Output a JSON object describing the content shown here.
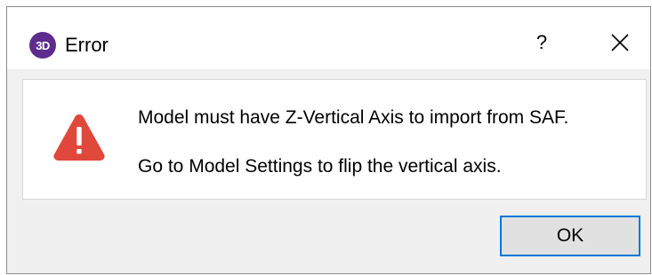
{
  "dialog": {
    "title": "Error",
    "app_icon_label": "3D",
    "help_label": "?",
    "close_icon": "close-icon",
    "warning_icon": "warning-icon",
    "warning_color": "#e0483b",
    "messages": [
      "Model must have Z-Vertical Axis to import from SAF.",
      "Go to Model Settings to flip the vertical axis."
    ],
    "ok_label": "OK",
    "accent_color": "#0078d7",
    "app_icon_color": "#5d2c8e"
  }
}
